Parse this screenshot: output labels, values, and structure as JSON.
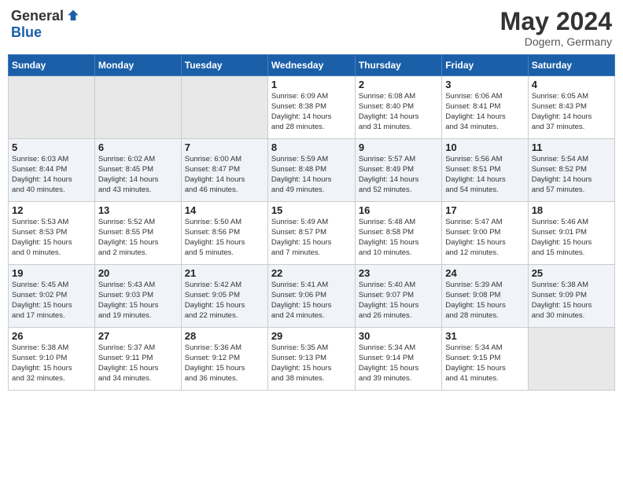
{
  "header": {
    "logo_general": "General",
    "logo_blue": "Blue",
    "month_year": "May 2024",
    "location": "Dogern, Germany"
  },
  "weekdays": [
    "Sunday",
    "Monday",
    "Tuesday",
    "Wednesday",
    "Thursday",
    "Friday",
    "Saturday"
  ],
  "weeks": [
    [
      {
        "day": "",
        "info": ""
      },
      {
        "day": "",
        "info": ""
      },
      {
        "day": "",
        "info": ""
      },
      {
        "day": "1",
        "info": "Sunrise: 6:09 AM\nSunset: 8:38 PM\nDaylight: 14 hours\nand 28 minutes."
      },
      {
        "day": "2",
        "info": "Sunrise: 6:08 AM\nSunset: 8:40 PM\nDaylight: 14 hours\nand 31 minutes."
      },
      {
        "day": "3",
        "info": "Sunrise: 6:06 AM\nSunset: 8:41 PM\nDaylight: 14 hours\nand 34 minutes."
      },
      {
        "day": "4",
        "info": "Sunrise: 6:05 AM\nSunset: 8:43 PM\nDaylight: 14 hours\nand 37 minutes."
      }
    ],
    [
      {
        "day": "5",
        "info": "Sunrise: 6:03 AM\nSunset: 8:44 PM\nDaylight: 14 hours\nand 40 minutes."
      },
      {
        "day": "6",
        "info": "Sunrise: 6:02 AM\nSunset: 8:45 PM\nDaylight: 14 hours\nand 43 minutes."
      },
      {
        "day": "7",
        "info": "Sunrise: 6:00 AM\nSunset: 8:47 PM\nDaylight: 14 hours\nand 46 minutes."
      },
      {
        "day": "8",
        "info": "Sunrise: 5:59 AM\nSunset: 8:48 PM\nDaylight: 14 hours\nand 49 minutes."
      },
      {
        "day": "9",
        "info": "Sunrise: 5:57 AM\nSunset: 8:49 PM\nDaylight: 14 hours\nand 52 minutes."
      },
      {
        "day": "10",
        "info": "Sunrise: 5:56 AM\nSunset: 8:51 PM\nDaylight: 14 hours\nand 54 minutes."
      },
      {
        "day": "11",
        "info": "Sunrise: 5:54 AM\nSunset: 8:52 PM\nDaylight: 14 hours\nand 57 minutes."
      }
    ],
    [
      {
        "day": "12",
        "info": "Sunrise: 5:53 AM\nSunset: 8:53 PM\nDaylight: 15 hours\nand 0 minutes."
      },
      {
        "day": "13",
        "info": "Sunrise: 5:52 AM\nSunset: 8:55 PM\nDaylight: 15 hours\nand 2 minutes."
      },
      {
        "day": "14",
        "info": "Sunrise: 5:50 AM\nSunset: 8:56 PM\nDaylight: 15 hours\nand 5 minutes."
      },
      {
        "day": "15",
        "info": "Sunrise: 5:49 AM\nSunset: 8:57 PM\nDaylight: 15 hours\nand 7 minutes."
      },
      {
        "day": "16",
        "info": "Sunrise: 5:48 AM\nSunset: 8:58 PM\nDaylight: 15 hours\nand 10 minutes."
      },
      {
        "day": "17",
        "info": "Sunrise: 5:47 AM\nSunset: 9:00 PM\nDaylight: 15 hours\nand 12 minutes."
      },
      {
        "day": "18",
        "info": "Sunrise: 5:46 AM\nSunset: 9:01 PM\nDaylight: 15 hours\nand 15 minutes."
      }
    ],
    [
      {
        "day": "19",
        "info": "Sunrise: 5:45 AM\nSunset: 9:02 PM\nDaylight: 15 hours\nand 17 minutes."
      },
      {
        "day": "20",
        "info": "Sunrise: 5:43 AM\nSunset: 9:03 PM\nDaylight: 15 hours\nand 19 minutes."
      },
      {
        "day": "21",
        "info": "Sunrise: 5:42 AM\nSunset: 9:05 PM\nDaylight: 15 hours\nand 22 minutes."
      },
      {
        "day": "22",
        "info": "Sunrise: 5:41 AM\nSunset: 9:06 PM\nDaylight: 15 hours\nand 24 minutes."
      },
      {
        "day": "23",
        "info": "Sunrise: 5:40 AM\nSunset: 9:07 PM\nDaylight: 15 hours\nand 26 minutes."
      },
      {
        "day": "24",
        "info": "Sunrise: 5:39 AM\nSunset: 9:08 PM\nDaylight: 15 hours\nand 28 minutes."
      },
      {
        "day": "25",
        "info": "Sunrise: 5:38 AM\nSunset: 9:09 PM\nDaylight: 15 hours\nand 30 minutes."
      }
    ],
    [
      {
        "day": "26",
        "info": "Sunrise: 5:38 AM\nSunset: 9:10 PM\nDaylight: 15 hours\nand 32 minutes."
      },
      {
        "day": "27",
        "info": "Sunrise: 5:37 AM\nSunset: 9:11 PM\nDaylight: 15 hours\nand 34 minutes."
      },
      {
        "day": "28",
        "info": "Sunrise: 5:36 AM\nSunset: 9:12 PM\nDaylight: 15 hours\nand 36 minutes."
      },
      {
        "day": "29",
        "info": "Sunrise: 5:35 AM\nSunset: 9:13 PM\nDaylight: 15 hours\nand 38 minutes."
      },
      {
        "day": "30",
        "info": "Sunrise: 5:34 AM\nSunset: 9:14 PM\nDaylight: 15 hours\nand 39 minutes."
      },
      {
        "day": "31",
        "info": "Sunrise: 5:34 AM\nSunset: 9:15 PM\nDaylight: 15 hours\nand 41 minutes."
      },
      {
        "day": "",
        "info": ""
      }
    ]
  ]
}
